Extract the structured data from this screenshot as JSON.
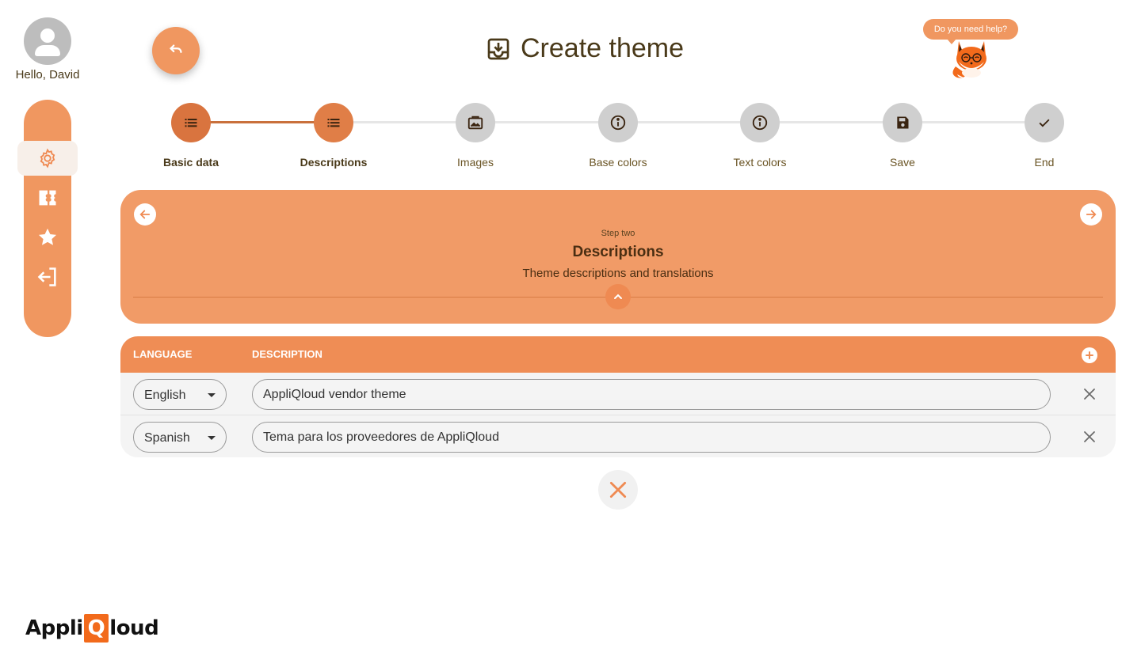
{
  "user": {
    "greeting": "Hello, David"
  },
  "page": {
    "title": "Create theme"
  },
  "help": {
    "label": "Do you need help?"
  },
  "stepper": {
    "steps": [
      {
        "label": "Basic data",
        "state": "done",
        "icon": "list-icon"
      },
      {
        "label": "Descriptions",
        "state": "current",
        "icon": "list-icon"
      },
      {
        "label": "Images",
        "state": "pending",
        "icon": "image-icon"
      },
      {
        "label": "Base colors",
        "state": "pending",
        "icon": "info-icon"
      },
      {
        "label": "Text colors",
        "state": "pending",
        "icon": "info-icon"
      },
      {
        "label": "Save",
        "state": "pending",
        "icon": "save-icon"
      },
      {
        "label": "End",
        "state": "pending",
        "icon": "check-icon"
      }
    ]
  },
  "info": {
    "step_small": "Step two",
    "title": "Descriptions",
    "subtitle": "Theme descriptions and translations"
  },
  "table": {
    "headers": {
      "language": "LANGUAGE",
      "description": "DESCRIPTION"
    },
    "rows": [
      {
        "language": "English",
        "description": "AppliQloud vendor theme"
      },
      {
        "language": "Spanish",
        "description": "Tema para los proveedores de AppliQloud"
      }
    ]
  },
  "logo": {
    "before": "Appli",
    "q": "Q",
    "after": "loud"
  },
  "colors": {
    "accent": "#f09760",
    "accent_dark": "#d9743f",
    "text": "#4a3a1a"
  }
}
